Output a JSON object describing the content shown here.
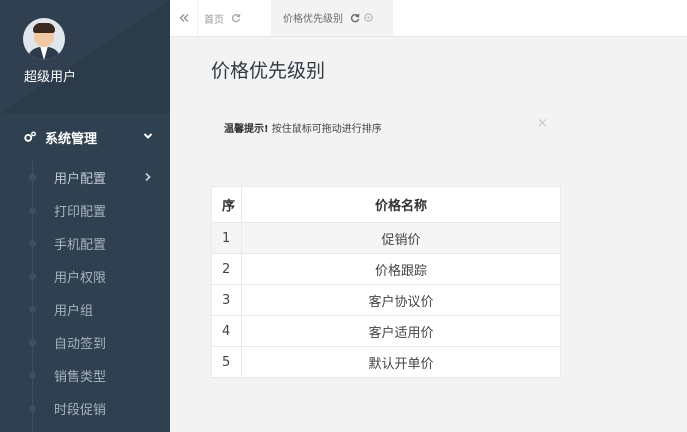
{
  "sidebar": {
    "user_name": "超级用户",
    "menu_title": "系统管理",
    "items": [
      {
        "label": "用户配置"
      },
      {
        "label": "打印配置"
      },
      {
        "label": "手机配置"
      },
      {
        "label": "用户权限"
      },
      {
        "label": "用户组"
      },
      {
        "label": "自动签到"
      },
      {
        "label": "销售类型"
      },
      {
        "label": "时段促销"
      }
    ]
  },
  "tabs": {
    "home": "首页",
    "current": "价格优先级别"
  },
  "page": {
    "title": "价格优先级别",
    "notice_strong": "温馨提示!",
    "notice_text": " 按住鼠标可拖动进行排序",
    "close": "×"
  },
  "table": {
    "headers": [
      "序",
      "价格名称"
    ],
    "rows": [
      {
        "no": "1",
        "name": "促销价"
      },
      {
        "no": "2",
        "name": "价格跟踪"
      },
      {
        "no": "3",
        "name": "客户协议价"
      },
      {
        "no": "4",
        "name": "客户适用价"
      },
      {
        "no": "5",
        "name": "默认开单价"
      }
    ]
  },
  "icons": {
    "back": "double-chevron-left-icon",
    "refresh": "refresh-icon",
    "close_tab": "close-circle-icon",
    "gear": "gears-icon",
    "chevron_down": "chevron-down-icon",
    "chevron_right": "chevron-right-icon"
  },
  "colors": {
    "sidebar_bg": "#2f4050",
    "sidebar_text": "#a7b1c2",
    "content_bg": "#f3f3f4",
    "table_border": "#e7eaec"
  }
}
